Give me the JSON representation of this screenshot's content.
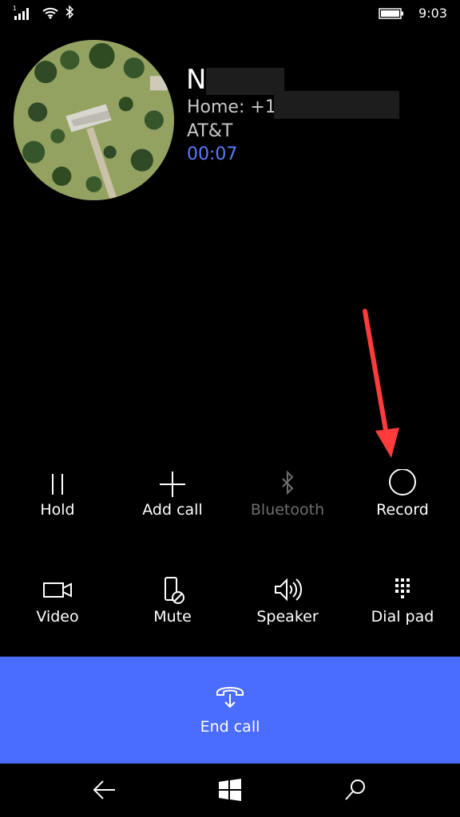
{
  "status_bar": {
    "signal_sim": "1",
    "time": "9:03"
  },
  "contact": {
    "name": "N",
    "number_prefix": "Home: +1",
    "carrier": "AT&T",
    "duration": "00:07"
  },
  "actions_row1": [
    {
      "label": "Hold",
      "icon": "pause-icon",
      "enabled": true
    },
    {
      "label": "Add call",
      "icon": "plus-icon",
      "enabled": true
    },
    {
      "label": "Bluetooth",
      "icon": "bluetooth-icon",
      "enabled": false
    },
    {
      "label": "Record",
      "icon": "record-icon",
      "enabled": true
    }
  ],
  "actions_row2": [
    {
      "label": "Video",
      "icon": "video-icon",
      "enabled": true
    },
    {
      "label": "Mute",
      "icon": "mute-icon",
      "enabled": true
    },
    {
      "label": "Speaker",
      "icon": "speaker-icon",
      "enabled": true
    },
    {
      "label": "Dial pad",
      "icon": "dialpad-icon",
      "enabled": true
    }
  ],
  "end_call": {
    "label": "End call",
    "color": "#4a6cff"
  },
  "nav": {
    "back": "back-icon",
    "home": "windows-icon",
    "search": "search-icon"
  },
  "colors": {
    "accent": "#5b7cff",
    "background": "#000000",
    "annotation": "#ff3b3b"
  }
}
